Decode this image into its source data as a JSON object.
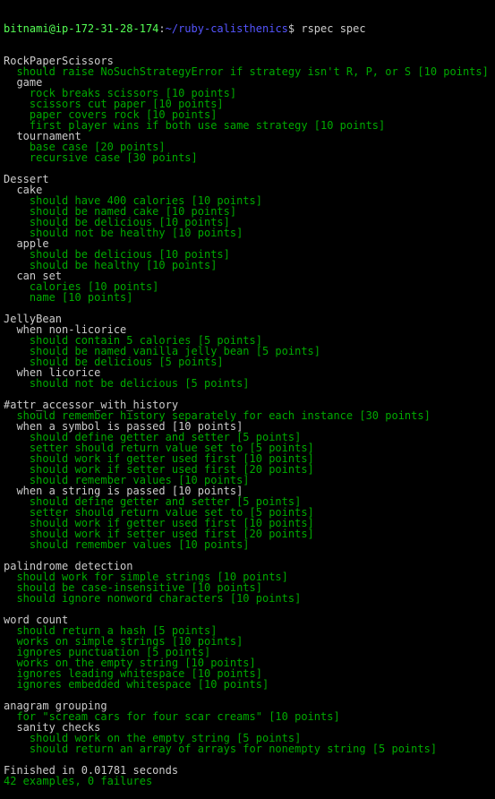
{
  "prompt": {
    "user_host": "bitnami@ip-172-31-28-174",
    "sep1": ":",
    "path": "~/ruby-calisthenics",
    "sep2": "$ ",
    "command": "rspec spec"
  },
  "lines": [
    {
      "t": "RockPaperScissors",
      "c": "white",
      "i": 0
    },
    {
      "t": "should raise NoSuchStrategyError if strategy isn't R, P, or S [10 points]",
      "c": "green",
      "i": 1
    },
    {
      "t": "game",
      "c": "white",
      "i": 1
    },
    {
      "t": "rock breaks scissors [10 points]",
      "c": "green",
      "i": 2
    },
    {
      "t": "scissors cut paper [10 points]",
      "c": "green",
      "i": 2
    },
    {
      "t": "paper covers rock [10 points]",
      "c": "green",
      "i": 2
    },
    {
      "t": "first player wins if both use same strategy [10 points]",
      "c": "green",
      "i": 2
    },
    {
      "t": "tournament",
      "c": "white",
      "i": 1
    },
    {
      "t": "base case [20 points]",
      "c": "green",
      "i": 2
    },
    {
      "t": "recursive case [30 points]",
      "c": "green",
      "i": 2
    },
    {
      "t": "",
      "c": "white",
      "i": 0
    },
    {
      "t": "Dessert",
      "c": "white",
      "i": 0
    },
    {
      "t": "cake",
      "c": "white",
      "i": 1
    },
    {
      "t": "should have 400 calories [10 points]",
      "c": "green",
      "i": 2
    },
    {
      "t": "should be named cake [10 points]",
      "c": "green",
      "i": 2
    },
    {
      "t": "should be delicious [10 points]",
      "c": "green",
      "i": 2
    },
    {
      "t": "should not be healthy [10 points]",
      "c": "green",
      "i": 2
    },
    {
      "t": "apple",
      "c": "white",
      "i": 1
    },
    {
      "t": "should be delicious [10 points]",
      "c": "green",
      "i": 2
    },
    {
      "t": "should be healthy [10 points]",
      "c": "green",
      "i": 2
    },
    {
      "t": "can set",
      "c": "white",
      "i": 1
    },
    {
      "t": "calories [10 points]",
      "c": "green",
      "i": 2
    },
    {
      "t": "name [10 points]",
      "c": "green",
      "i": 2
    },
    {
      "t": "",
      "c": "white",
      "i": 0
    },
    {
      "t": "JellyBean",
      "c": "white",
      "i": 0
    },
    {
      "t": "when non-licorice",
      "c": "white",
      "i": 1
    },
    {
      "t": "should contain 5 calories [5 points]",
      "c": "green",
      "i": 2
    },
    {
      "t": "should be named vanilla jelly bean [5 points]",
      "c": "green",
      "i": 2
    },
    {
      "t": "should be delicious [5 points]",
      "c": "green",
      "i": 2
    },
    {
      "t": "when licorice",
      "c": "white",
      "i": 1
    },
    {
      "t": "should not be delicious [5 points]",
      "c": "green",
      "i": 2
    },
    {
      "t": "",
      "c": "white",
      "i": 0
    },
    {
      "t": "#attr_accessor_with_history",
      "c": "white",
      "i": 0
    },
    {
      "t": "should remember history separately for each instance [30 points]",
      "c": "green",
      "i": 1
    },
    {
      "t": "when a symbol is passed [10 points]",
      "c": "white",
      "i": 1
    },
    {
      "t": "should define getter and setter [5 points]",
      "c": "green",
      "i": 2
    },
    {
      "t": "setter should return value set to [5 points]",
      "c": "green",
      "i": 2
    },
    {
      "t": "should work if getter used first [10 points]",
      "c": "green",
      "i": 2
    },
    {
      "t": "should work if setter used first [20 points]",
      "c": "green",
      "i": 2
    },
    {
      "t": "should remember values [10 points]",
      "c": "green",
      "i": 2
    },
    {
      "t": "when a string is passed [10 points]",
      "c": "white",
      "i": 1
    },
    {
      "t": "should define getter and setter [5 points]",
      "c": "green",
      "i": 2
    },
    {
      "t": "setter should return value set to [5 points]",
      "c": "green",
      "i": 2
    },
    {
      "t": "should work if getter used first [10 points]",
      "c": "green",
      "i": 2
    },
    {
      "t": "should work if setter used first [20 points]",
      "c": "green",
      "i": 2
    },
    {
      "t": "should remember values [10 points]",
      "c": "green",
      "i": 2
    },
    {
      "t": "",
      "c": "white",
      "i": 0
    },
    {
      "t": "palindrome detection",
      "c": "white",
      "i": 0
    },
    {
      "t": "should work for simple strings [10 points]",
      "c": "green",
      "i": 1
    },
    {
      "t": "should be case-insensitive [10 points]",
      "c": "green",
      "i": 1
    },
    {
      "t": "should ignore nonword characters [10 points]",
      "c": "green",
      "i": 1
    },
    {
      "t": "",
      "c": "white",
      "i": 0
    },
    {
      "t": "word count",
      "c": "white",
      "i": 0
    },
    {
      "t": "should return a hash [5 points]",
      "c": "green",
      "i": 1
    },
    {
      "t": "works on simple strings [10 points]",
      "c": "green",
      "i": 1
    },
    {
      "t": "ignores punctuation [5 points]",
      "c": "green",
      "i": 1
    },
    {
      "t": "works on the empty string [10 points]",
      "c": "green",
      "i": 1
    },
    {
      "t": "ignores leading whitespace [10 points]",
      "c": "green",
      "i": 1
    },
    {
      "t": "ignores embedded whitespace [10 points]",
      "c": "green",
      "i": 1
    },
    {
      "t": "",
      "c": "white",
      "i": 0
    },
    {
      "t": "anagram grouping",
      "c": "white",
      "i": 0
    },
    {
      "t": "for \"scream cars for four scar creams\" [10 points]",
      "c": "green",
      "i": 1
    },
    {
      "t": "sanity checks",
      "c": "white",
      "i": 1
    },
    {
      "t": "should work on the empty string [5 points]",
      "c": "green",
      "i": 2
    },
    {
      "t": "should return an array of arrays for nonempty string [5 points]",
      "c": "green",
      "i": 2
    },
    {
      "t": "",
      "c": "white",
      "i": 0
    },
    {
      "t": "Finished in 0.01781 seconds",
      "c": "white",
      "i": 0
    },
    {
      "t": "42 examples, 0 failures",
      "c": "green",
      "i": 0
    }
  ]
}
